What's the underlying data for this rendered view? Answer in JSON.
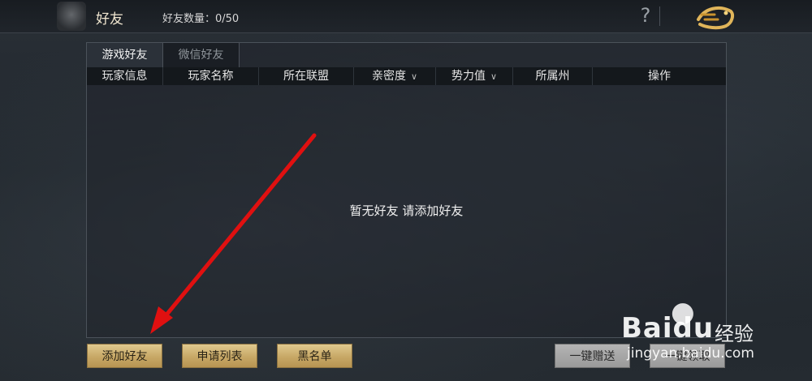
{
  "header": {
    "title": "好友",
    "friend_count_label": "好友数量：0/50",
    "help_label": "?"
  },
  "tabs": [
    {
      "label": "游戏好友",
      "active": true
    },
    {
      "label": "微信好友",
      "active": false
    }
  ],
  "table": {
    "columns": [
      {
        "label": "玩家信息",
        "sortable": false
      },
      {
        "label": "玩家名称",
        "sortable": false
      },
      {
        "label": "所在联盟",
        "sortable": false
      },
      {
        "label": "亲密度",
        "sortable": true
      },
      {
        "label": "势力值",
        "sortable": true
      },
      {
        "label": "所属州",
        "sortable": false
      },
      {
        "label": "操作",
        "sortable": false
      }
    ],
    "empty_message": "暂无好友 请添加好友"
  },
  "buttons": {
    "add_friend": "添加好友",
    "request_list": "申请列表",
    "blacklist": "黑名单",
    "gift_all": "一键赠送",
    "collect_all": "一键领取"
  },
  "watermark": {
    "brand": "Bai",
    "brand_suffix": "du",
    "jingyan": "经验",
    "url": "jingyan.baidu.com"
  },
  "colors": {
    "gold_button": "#c7a866",
    "gray_button": "#9a9a9a",
    "arrow": "#e01010"
  }
}
